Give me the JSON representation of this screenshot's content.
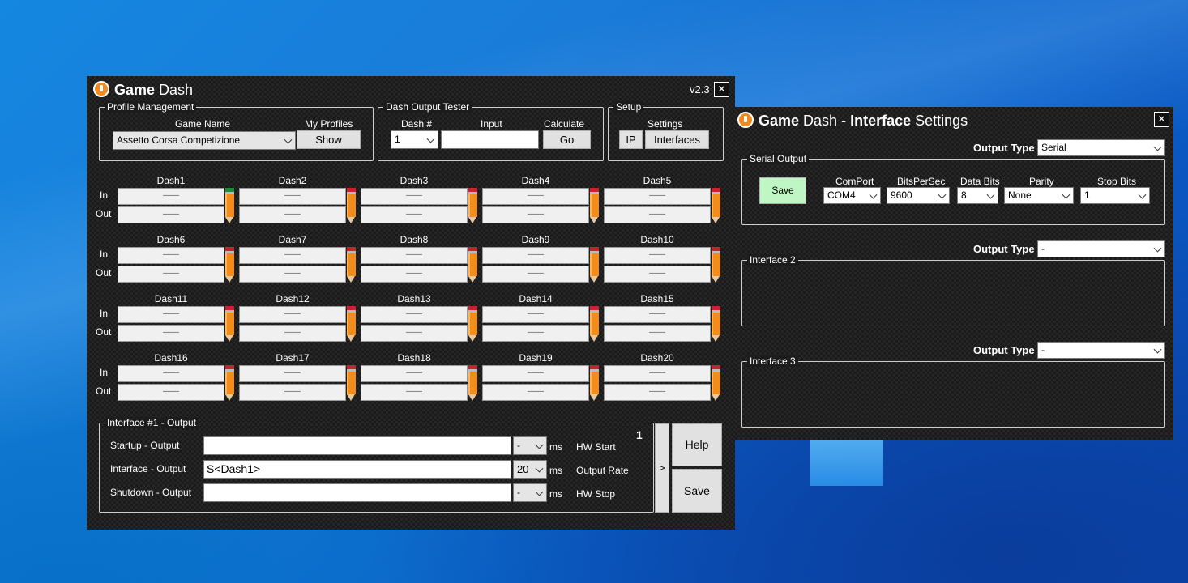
{
  "main": {
    "title_bold": "Game",
    "title_rest": "Dash",
    "version": "v2.3",
    "close": "✕",
    "profile": {
      "group": "Profile Management",
      "game_name_label": "Game Name",
      "my_profiles_label": "My Profiles",
      "game_value": "Assetto Corsa Competizione",
      "show": "Show"
    },
    "tester": {
      "group": "Dash Output Tester",
      "dash_label": "Dash #",
      "input_label": "Input",
      "calc_label": "Calculate",
      "dash_value": "1",
      "input_value": "",
      "go": "Go"
    },
    "setup": {
      "group": "Setup",
      "settings_label": "Settings",
      "ip": "IP",
      "interfaces": "Interfaces"
    },
    "in_label": "In",
    "out_label": "Out",
    "dash_placeholder": "——",
    "dashes": [
      "Dash1",
      "Dash2",
      "Dash3",
      "Dash4",
      "Dash5",
      "Dash6",
      "Dash7",
      "Dash8",
      "Dash9",
      "Dash10",
      "Dash11",
      "Dash12",
      "Dash13",
      "Dash14",
      "Dash15",
      "Dash16",
      "Dash17",
      "Dash18",
      "Dash19",
      "Dash20"
    ],
    "output": {
      "group": "Interface #1 - Output",
      "index": "1",
      "startup_label": "Startup - Output",
      "interface_label": "Interface - Output",
      "shutdown_label": "Shutdown - Output",
      "startup_value": "",
      "interface_value": "S<Dash1>",
      "shutdown_value": "",
      "startup_ms": "-",
      "interface_ms": "20",
      "shutdown_ms": "-",
      "ms": "ms",
      "hw_start": "HW Start",
      "output_rate": "Output Rate",
      "hw_stop": "HW Stop",
      "next": ">",
      "help": "Help",
      "save": "Save"
    }
  },
  "settings": {
    "title_bold1": "Game",
    "title_mid": "Dash - ",
    "title_bold2": "Interface",
    "title_rest": "Settings",
    "close": "✕",
    "output_type_label": "Output Type",
    "iface1": {
      "output_type": "Serial",
      "group": "Serial Output",
      "save": "Save",
      "comport_label": "ComPort",
      "bps_label": "BitsPerSec",
      "databits_label": "Data Bits",
      "parity_label": "Parity",
      "stopbits_label": "Stop Bits",
      "comport": "COM4",
      "bps": "9600",
      "databits": "8",
      "parity": "None",
      "stopbits": "1"
    },
    "iface2": {
      "output_type": "-",
      "group": "Interface 2"
    },
    "iface3": {
      "output_type": "-",
      "group": "Interface 3"
    }
  }
}
